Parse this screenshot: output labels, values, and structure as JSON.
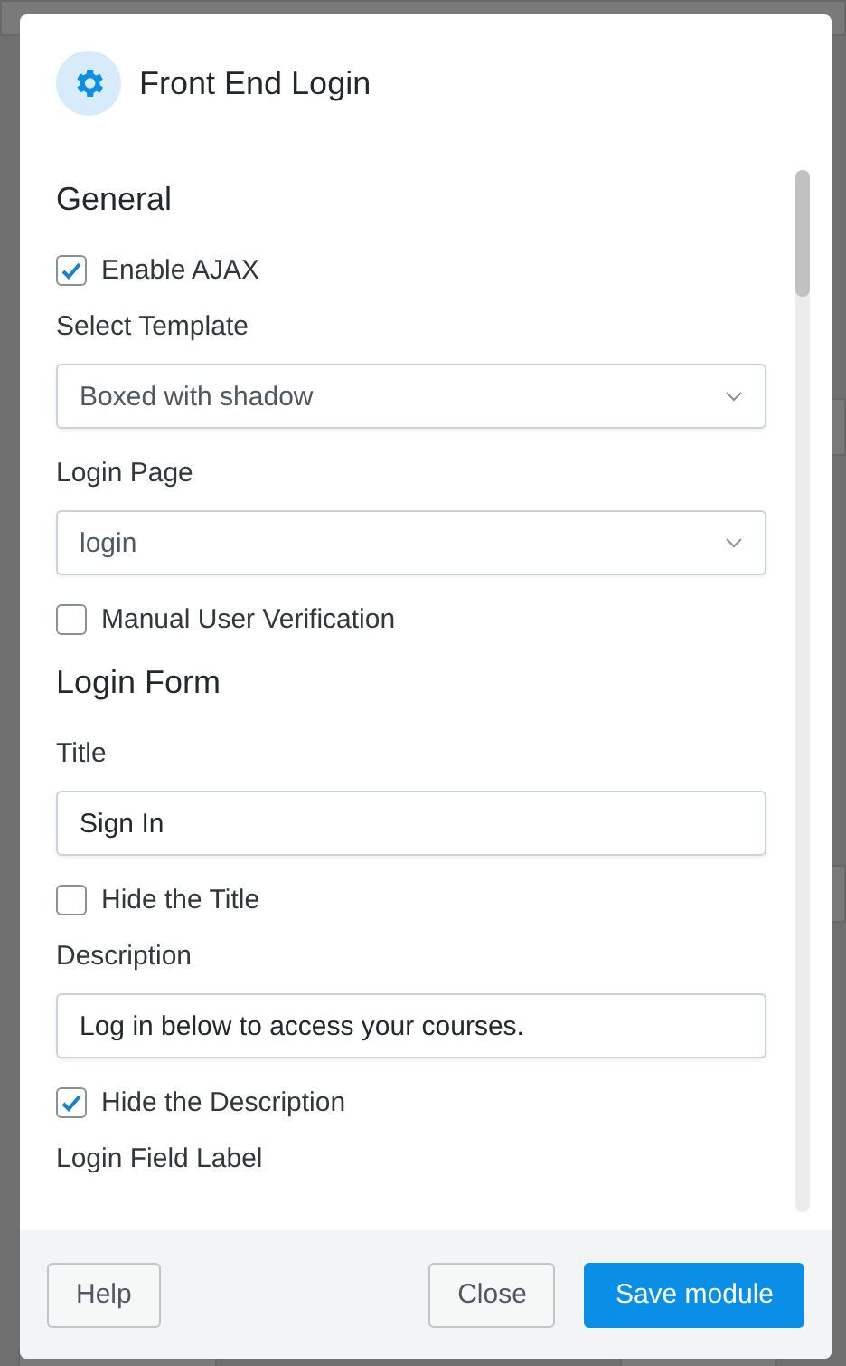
{
  "dialog": {
    "title": "Front End Login"
  },
  "fields": [
    {
      "kind": "heading",
      "text": "General"
    },
    {
      "kind": "checkbox",
      "label": "Enable AJAX",
      "checked": true
    },
    {
      "kind": "label",
      "text": "Select Template"
    },
    {
      "kind": "select",
      "value": "Boxed with shadow"
    },
    {
      "kind": "label",
      "text": "Login Page"
    },
    {
      "kind": "select",
      "value": "login"
    },
    {
      "kind": "checkbox",
      "label": "Manual User Verification",
      "checked": false
    },
    {
      "kind": "heading",
      "text": "Login Form"
    },
    {
      "kind": "label",
      "text": "Title"
    },
    {
      "kind": "input",
      "value": "Sign In"
    },
    {
      "kind": "checkbox",
      "label": "Hide the Title",
      "checked": false
    },
    {
      "kind": "label",
      "text": "Description"
    },
    {
      "kind": "input",
      "value": "Log in below to access your courses."
    },
    {
      "kind": "checkbox",
      "label": "Hide the Description",
      "checked": true
    },
    {
      "kind": "label",
      "text": "Login Field Label"
    }
  ],
  "footer": {
    "help": "Help",
    "close": "Close",
    "save": "Save module"
  }
}
